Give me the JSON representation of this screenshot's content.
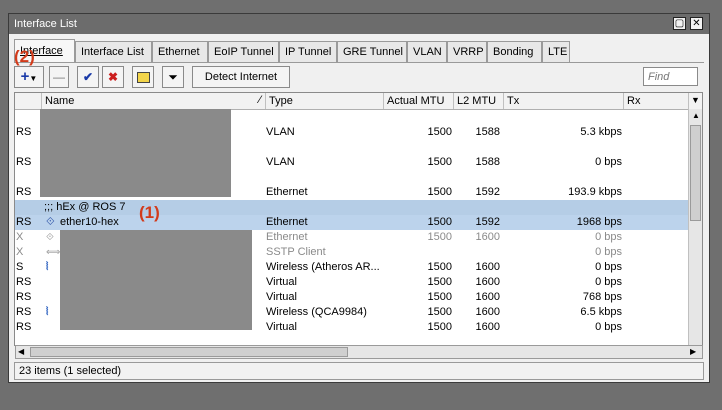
{
  "window": {
    "title": "Interface List"
  },
  "tabs": [
    "Interface",
    "Interface List",
    "Ethernet",
    "EoIP Tunnel",
    "IP Tunnel",
    "GRE Tunnel",
    "VLAN",
    "VRRP",
    "Bonding",
    "LTE"
  ],
  "toolbar": {
    "detect_label": "Detect Internet",
    "find_placeholder": "Find"
  },
  "annotations": {
    "a1": "(1)",
    "a2": "(2)"
  },
  "columns": {
    "name": "Name",
    "type": "Type",
    "actual_mtu": "Actual MTU",
    "l2_mtu": "L2 MTU",
    "tx": "Tx",
    "rx": "Rx"
  },
  "rows": [
    {
      "flags": "",
      "name": ";;;",
      "type": "",
      "mtu": "",
      "l2": "",
      "tx": ""
    },
    {
      "flags": "RS",
      "name": "",
      "type": "VLAN",
      "mtu": "1500",
      "l2": "1588",
      "tx": "5.3 kbps"
    },
    {
      "flags": "",
      "name": ";;;",
      "type": "",
      "mtu": "",
      "l2": "",
      "tx": ""
    },
    {
      "flags": "RS",
      "name": "",
      "type": "VLAN",
      "mtu": "1500",
      "l2": "1588",
      "tx": "0 bps"
    },
    {
      "flags": "",
      "name": ";;;",
      "type": "",
      "mtu": "",
      "l2": "",
      "tx": ""
    },
    {
      "flags": "RS",
      "name": "",
      "type": "Ethernet",
      "mtu": "1500",
      "l2": "1592",
      "tx": "193.9 kbps"
    },
    {
      "flags": "",
      "name": ";;; hEx @ ROS 7",
      "type": "",
      "mtu": "",
      "l2": "",
      "tx": ""
    },
    {
      "flags": "RS",
      "name": "ether10-hex",
      "type": "Ethernet",
      "mtu": "1500",
      "l2": "1592",
      "tx": "1968 bps"
    },
    {
      "flags": "X",
      "name": "",
      "type": "Ethernet",
      "mtu": "1500",
      "l2": "1600",
      "tx": "0 bps"
    },
    {
      "flags": "X",
      "name": "",
      "type": "SSTP Client",
      "mtu": "",
      "l2": "",
      "tx": "0 bps"
    },
    {
      "flags": "S",
      "name": "",
      "type": "Wireless (Atheros AR...",
      "mtu": "1500",
      "l2": "1600",
      "tx": "0 bps"
    },
    {
      "flags": "RS",
      "name": "",
      "type": "Virtual",
      "mtu": "1500",
      "l2": "1600",
      "tx": "0 bps"
    },
    {
      "flags": "RS",
      "name": "",
      "type": "Virtual",
      "mtu": "1500",
      "l2": "1600",
      "tx": "768 bps"
    },
    {
      "flags": "RS",
      "name": "",
      "type": "Wireless (QCA9984)",
      "mtu": "1500",
      "l2": "1600",
      "tx": "6.5 kbps"
    },
    {
      "flags": "RS",
      "name": "",
      "type": "Virtual",
      "mtu": "1500",
      "l2": "1600",
      "tx": "0 bps"
    }
  ],
  "status": "23 items (1 selected)",
  "colors": {
    "selected_row": "#bcd3ec",
    "annotation": "#d23b1b",
    "titlebar": "#6c6c6c"
  }
}
